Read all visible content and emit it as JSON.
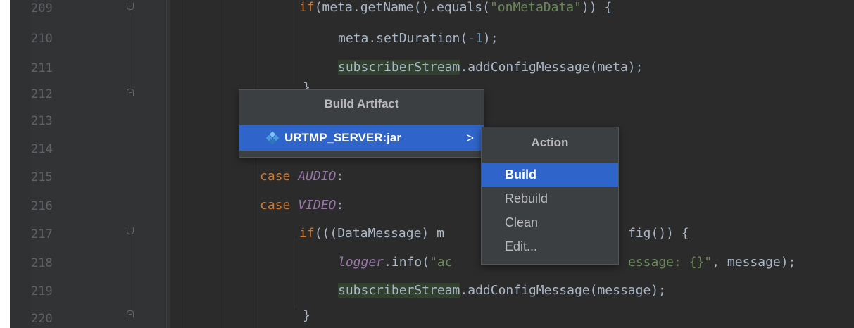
{
  "line_numbers": [
    "209",
    "210",
    "211",
    "212",
    "213",
    "214",
    "215",
    "216",
    "217",
    "218",
    "219",
    "220"
  ],
  "code": {
    "l209": {
      "kw": "if",
      "pre": "(meta.getName().equals(",
      "str": "\"onMetaData\"",
      "post": ")) {"
    },
    "l210": {
      "pre": "meta.setDuration(",
      "num": "-1",
      "post": ");"
    },
    "l211": {
      "hl": "subscriberStream",
      "post": ".addConfigMessage(meta);"
    },
    "l212": {
      "text": "}"
    },
    "l215": {
      "kw": "case ",
      "fld": "AUDIO",
      "post": ":"
    },
    "l216": {
      "kw": "case ",
      "fld": "VIDEO",
      "post": ":"
    },
    "l217": {
      "kw": "if",
      "pre": "(((DataMessage) m",
      "post": "fig()) {"
    },
    "l218": {
      "fld": "logger",
      "pre": ".info(",
      "str1": "\"ac",
      "str2": "essage: {}\"",
      "post": ", message);"
    },
    "l219": {
      "hl": "subscriberStream",
      "post": ".addConfigMessage(message);"
    },
    "l220": {
      "text": "}"
    }
  },
  "artifact_popup": {
    "title": "Build Artifact",
    "item_label": "URTMP_SERVER:jar",
    "item_chevron": ">",
    "item_icon": "artifact-diamond-icon",
    "selected_color": "#2f65ca"
  },
  "action_popup": {
    "title": "Action",
    "items": [
      "Build",
      "Rebuild",
      "Clean",
      "Edit..."
    ],
    "selected": "Build"
  },
  "colors": {
    "background": "#2b2b2b",
    "keyword": "#cc7832",
    "field": "#9876aa",
    "string": "#6a8759",
    "number": "#6897bb",
    "text": "#a9b7c6"
  }
}
